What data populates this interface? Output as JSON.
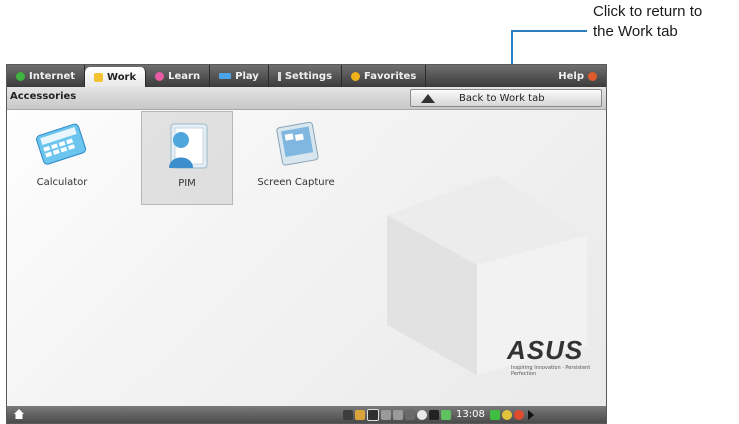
{
  "annotation": {
    "top_right_text_line1": "Click to return to",
    "top_right_text_line2": "the Work tab"
  },
  "tabs": [
    {
      "label": "Internet",
      "icon": "internet-icon",
      "color": "#3fb53f"
    },
    {
      "label": "Work",
      "icon": "work-icon",
      "color": "#f2c230",
      "active": true
    },
    {
      "label": "Learn",
      "icon": "learn-icon",
      "color": "#e85aa4"
    },
    {
      "label": "Play",
      "icon": "play-icon",
      "color": "#4aa3e8"
    },
    {
      "label": "Settings",
      "icon": "settings-icon",
      "color": "#dcdcdc"
    },
    {
      "label": "Favorites",
      "icon": "favorites-icon",
      "color": "#f0b21a"
    },
    {
      "label": "Help",
      "icon": "help-icon",
      "color": "#e05a2b"
    }
  ],
  "breadcrumb": "Accessories",
  "back_button": "Back to Work tab",
  "apps": [
    {
      "label": "Calculator",
      "icon": "calculator-icon"
    },
    {
      "label": "PIM",
      "icon": "pim-icon"
    },
    {
      "label": "Screen Capture",
      "icon": "screen-capture-icon"
    }
  ],
  "brand": {
    "logo": "ASUS",
    "slogan": "Inspiring Innovation · Persistent Perfection"
  },
  "taskbar": {
    "clock": "13:08"
  }
}
